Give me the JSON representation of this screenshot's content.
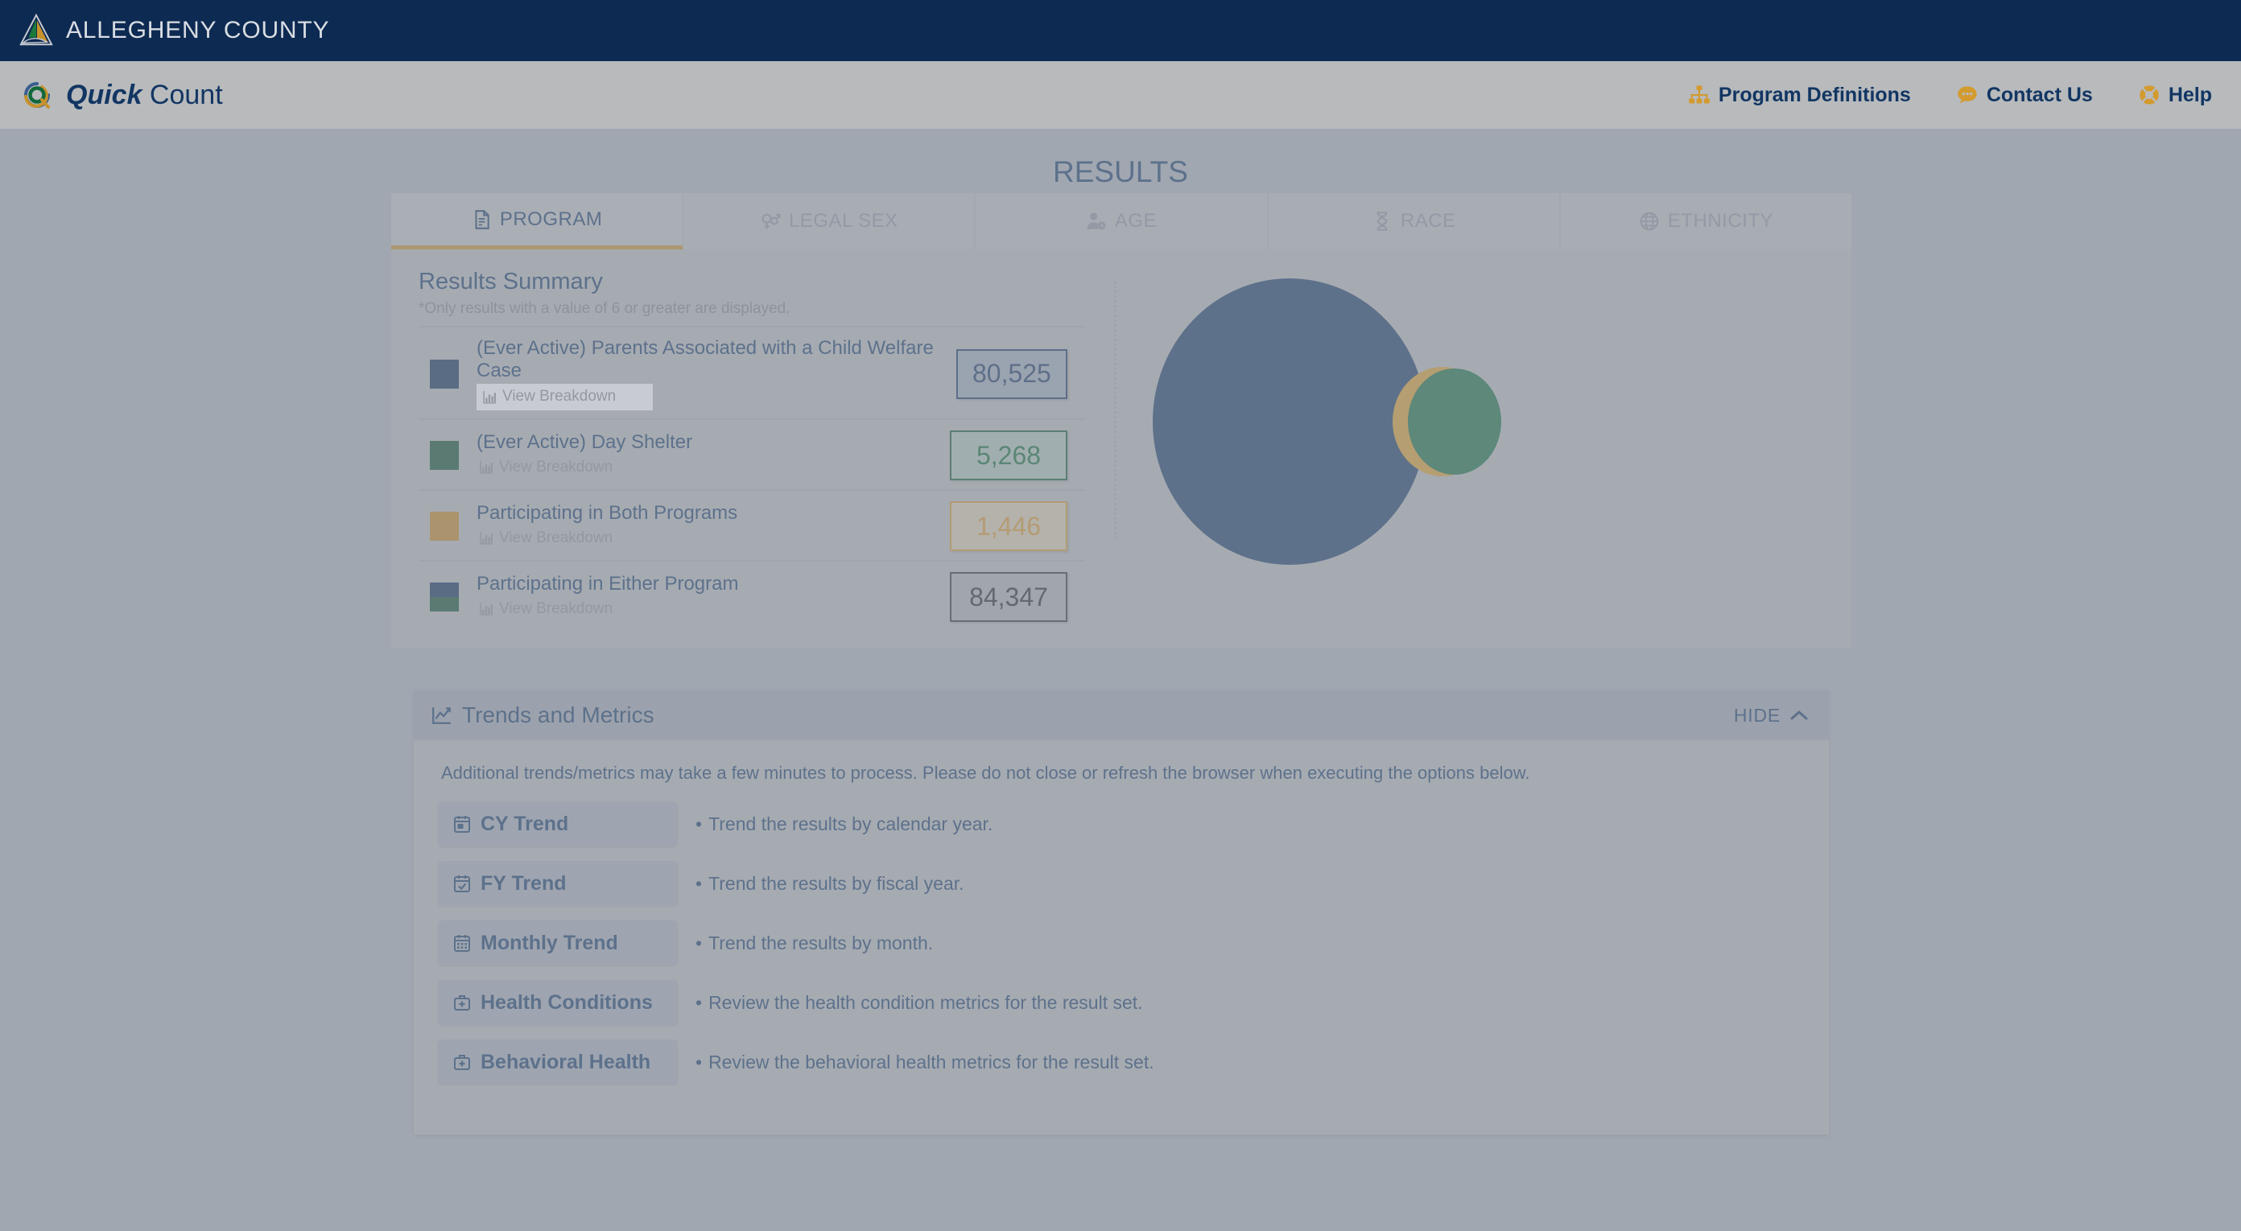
{
  "county_bar": {
    "title": "ALLEGHENY COUNTY",
    "logo_icon": "allegheny-triangle-logo"
  },
  "brand": {
    "name_bold": "Quick",
    "name_light": " Count",
    "logo_icon": "quick-count-swirl-logo"
  },
  "nav": [
    {
      "label": "Program Definitions",
      "icon": "sitemap-icon"
    },
    {
      "label": "Contact Us",
      "icon": "comment-dots-icon"
    },
    {
      "label": "Help",
      "icon": "life-ring-icon"
    }
  ],
  "page": {
    "title": "RESULTS"
  },
  "tabs": [
    {
      "label": "PROGRAM",
      "icon": "file-lines-icon",
      "active": true
    },
    {
      "label": "LEGAL SEX",
      "icon": "venus-mars-icon",
      "active": false
    },
    {
      "label": "AGE",
      "icon": "user-clock-icon",
      "active": false
    },
    {
      "label": "RACE",
      "icon": "dna-icon",
      "active": false
    },
    {
      "label": "ETHNICITY",
      "icon": "globe-icon",
      "active": false
    }
  ],
  "summary": {
    "heading": "Results Summary",
    "note": "*Only results with a value of 6 or greater are displayed.",
    "breakdown_label": "View Breakdown",
    "rows": [
      {
        "label": "(Ever Active) Parents Associated with a Child Welfare Case",
        "value": "80,525",
        "swatch": "navy",
        "value_style": "val-navy",
        "focused": true
      },
      {
        "label": "(Ever Active) Day Shelter",
        "value": "5,268",
        "swatch": "green",
        "value_style": "val-green",
        "focused": false
      },
      {
        "label": "Participating in Both Programs",
        "value": "1,446",
        "swatch": "gold",
        "value_style": "val-gold",
        "focused": false
      },
      {
        "label": "Participating in Either Program",
        "value": "84,347",
        "swatch": "split",
        "value_style": "val-grey",
        "focused": false
      }
    ]
  },
  "chart_data": {
    "type": "venn",
    "title": "",
    "sets": [
      {
        "name": "(Ever Active) Parents Associated with a Child Welfare Case",
        "value": 80525,
        "color": "#163560"
      },
      {
        "name": "(Ever Active) Day Shelter",
        "value": 5268,
        "color": "#12683c"
      }
    ],
    "intersection": {
      "name": "Participating in Both Programs",
      "value": 1446,
      "color": "#d59a29"
    },
    "union": {
      "name": "Participating in Either Program",
      "value": 84347
    },
    "legend_position": "left-list",
    "grid": false
  },
  "trends": {
    "title": "Trends and Metrics",
    "title_icon": "chart-line-icon",
    "hide_label": "HIDE",
    "hide_icon": "chevron-up-icon",
    "note": "Additional trends/metrics may take a few minutes to process. Please do not close or refresh the browser when executing the options below.",
    "items": [
      {
        "label": "CY Trend",
        "icon": "calendar-day-icon",
        "desc": "Trend the results by calendar year."
      },
      {
        "label": "FY Trend",
        "icon": "calendar-check-icon",
        "desc": "Trend the results by fiscal year."
      },
      {
        "label": "Monthly Trend",
        "icon": "calendar-days-icon",
        "desc": "Trend the results by month."
      },
      {
        "label": "Health Conditions",
        "icon": "briefcase-medical-icon",
        "desc": "Review the health condition metrics for the result set."
      },
      {
        "label": "Behavioral Health",
        "icon": "briefcase-medical-icon",
        "desc": "Review the behavioral health metrics for the result set."
      }
    ]
  },
  "colors": {
    "navy": "#0d2a52",
    "green": "#0d4a2a",
    "gold": "#bf8021",
    "accent": "#c28b28",
    "page_bg": "#b4b6b8"
  }
}
